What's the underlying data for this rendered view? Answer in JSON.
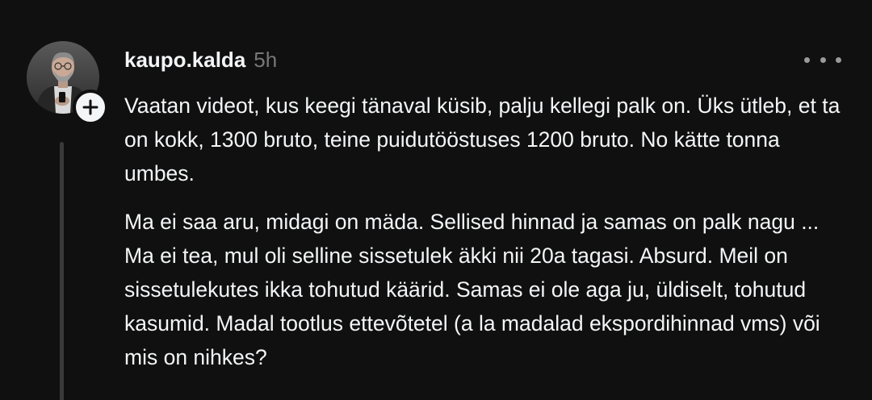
{
  "post": {
    "username": "kaupo.kalda",
    "timestamp": "5h",
    "paragraphs": [
      "Vaatan videot, kus keegi tänaval küsib, palju kellegi palk on. Üks ütleb, et ta on kokk, 1300 bruto, teine puidutööstuses 1200 bruto. No kätte tonna umbes.",
      "Ma ei saa aru, midagi on mäda. Sellised hinnad ja samas on palk nagu ... Ma ei tea, mul oli selline sissetulek äkki nii 20a tagasi. Absurd. Meil on sissetulekutes ikka tohutud käärid. Samas ei ole aga ju, üldiselt, tohutud kasumid. Madal tootlus ettevõtetel (a la madalad ekspordihinnad vms) või mis on nihkes?"
    ]
  },
  "icons": {
    "avatar": "profile-photo",
    "follow": "plus-icon",
    "more": "more-horizontal-icon"
  },
  "colors": {
    "background": "#101010",
    "text": "#f3f5f7",
    "muted": "#777777",
    "thread_line": "#3a3a3a"
  }
}
